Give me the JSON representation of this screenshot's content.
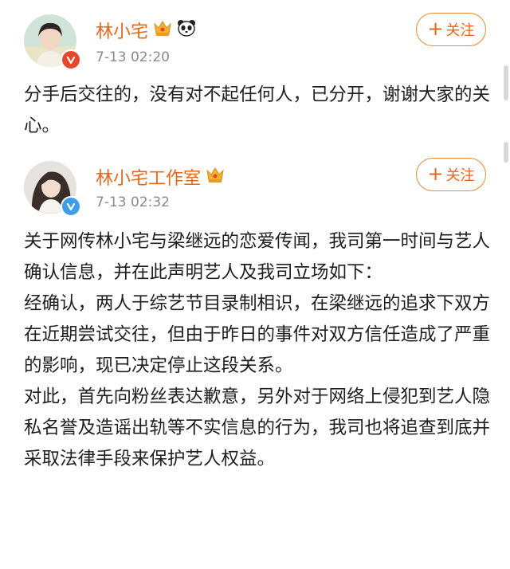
{
  "colors": {
    "name": "#e8661a",
    "follow_border": "#ee8733",
    "time": "#8a8a8a",
    "text": "#1e1e1e",
    "verified_red": "#e8462a",
    "verified_blue": "#3f9ce8"
  },
  "posts": [
    {
      "user": "林小宅",
      "badges": [
        "crown-icon",
        "panda-icon"
      ],
      "verified": "verified-red-icon",
      "time": "7-13 02:20",
      "follow_label": "关注",
      "follow_icon": "plus-icon",
      "paragraphs": [
        "分手后交往的，没有对不起任何人，已分开，谢谢大家的关心。"
      ]
    },
    {
      "user": "林小宅工作室",
      "badges": [
        "crown-icon"
      ],
      "verified": "verified-blue-icon",
      "time": "7-13 02:32",
      "follow_label": "关注",
      "follow_icon": "plus-icon",
      "paragraphs": [
        "关于网传林小宅与梁继远的恋爱传闻，我司第一时间与艺人确认信息，并在此声明艺人及我司立场如下：",
        "经确认，两人于综艺节目录制相识，在梁继远的追求下双方在近期尝试交往，但由于昨日的事件对双方信任造成了严重的影响，现已决定停止这段关系。",
        "对此，首先向粉丝表达歉意，另外对于网络上侵犯到艺人隐私名誉及造谣出轨等不实信息的行为，我司也将追查到底并采取法律手段来保护艺人权益。"
      ]
    }
  ]
}
